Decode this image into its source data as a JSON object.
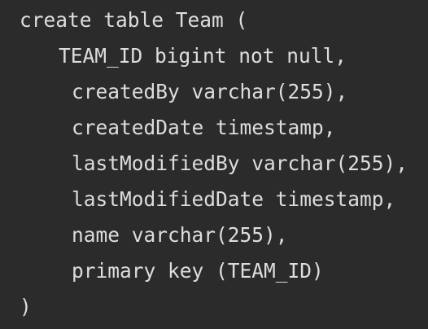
{
  "code": {
    "lines": [
      "create table Team (",
      "TEAM_ID bigint not null,",
      "createdBy varchar(255),",
      "createdDate timestamp,",
      "lastModifiedBy varchar(255),",
      "lastModifiedDate timestamp,",
      "name varchar(255),",
      "primary key (TEAM_ID)",
      ")"
    ]
  },
  "colors": {
    "background": "#2b2b2b",
    "text": "#dddddd"
  }
}
